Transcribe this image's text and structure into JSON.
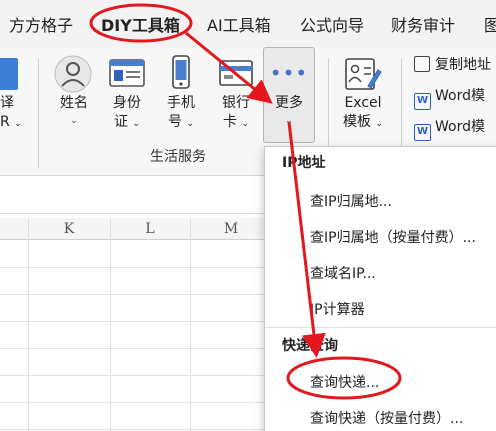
{
  "tabs": [
    "方方格子",
    "DIY工具箱",
    "AI工具箱",
    "公式向导",
    "财务审计",
    "图"
  ],
  "ribbon": {
    "translate_partial": "译",
    "translate_partial2": "R",
    "buttons": [
      {
        "line1": "姓名",
        "line2": ""
      },
      {
        "line1": "身份",
        "line2": "证"
      },
      {
        "line1": "手机",
        "line2": "号"
      },
      {
        "line1": "银行",
        "line2": "卡"
      },
      {
        "line1": "更多",
        "line2": ""
      },
      {
        "line1": "Excel",
        "line2": "模板"
      }
    ],
    "group_label": "生活服务",
    "small_items": [
      "复制地址",
      "Word模",
      "Word模"
    ]
  },
  "sheet": {
    "columns": [
      "K",
      "L",
      "M"
    ]
  },
  "dropdown": {
    "sections": [
      {
        "title": "IP地址",
        "items": [
          "查IP归属地...",
          "查IP归属地（按量付费）...",
          "查域名IP...",
          "IP计算器"
        ]
      },
      {
        "title": "快递查询",
        "items": [
          "查询快递...",
          "查询快递（按量付费）..."
        ]
      }
    ]
  },
  "annotation": {
    "color": "#e3171d"
  }
}
